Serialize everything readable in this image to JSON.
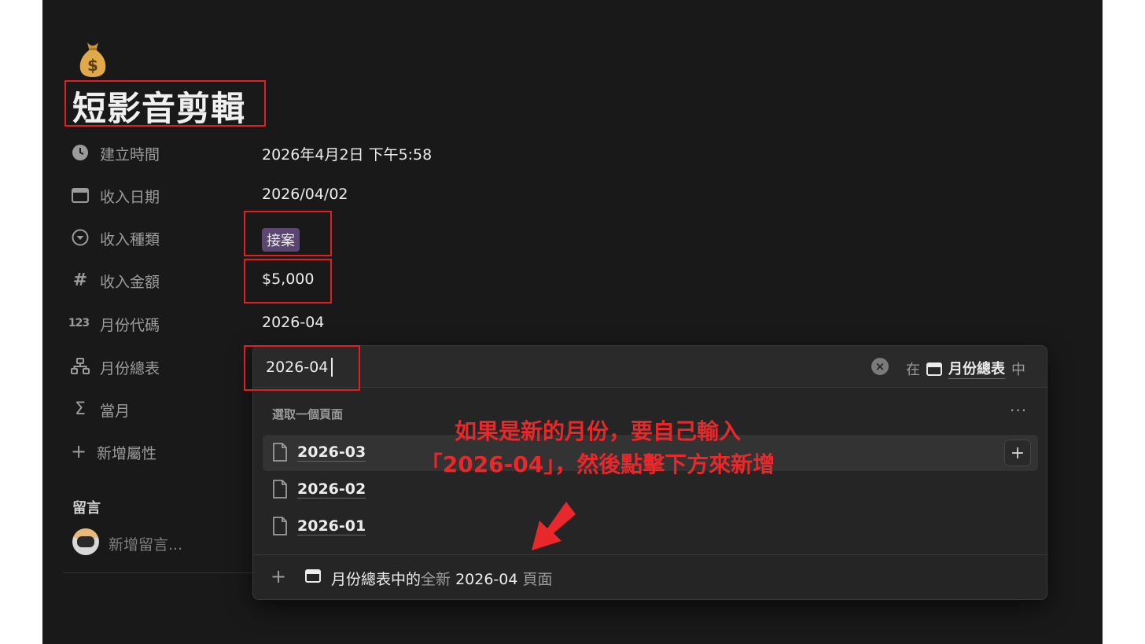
{
  "page": {
    "icon": "money-bag-icon",
    "title": "短影音剪輯"
  },
  "properties": [
    {
      "icon": "clock-icon",
      "label": "建立時間",
      "value": "2026年4月2日 下午5:58"
    },
    {
      "icon": "calendar-icon",
      "label": "收入日期",
      "value": "2026/04/02"
    },
    {
      "icon": "select-icon",
      "label": "收入種類",
      "tag": "接案",
      "tag_color": "#5a4670"
    },
    {
      "icon": "hash-icon",
      "label": "收入金額",
      "value": "$5,000"
    },
    {
      "icon": "formula-123-icon",
      "label": "月份代碼",
      "value": "2026-04"
    },
    {
      "icon": "relation-icon",
      "label": "月份總表"
    },
    {
      "icon": "sigma-icon",
      "label": "當月"
    },
    {
      "icon": "plus-icon",
      "label": "新增屬性"
    }
  ],
  "comments": {
    "label": "留言",
    "placeholder": "新增留言..."
  },
  "relation_popup": {
    "search_value": "2026-04",
    "in_prefix": "在",
    "database_name": "月份總表",
    "in_suffix": "中",
    "section_label": "選取一個頁面",
    "more_label": "···",
    "options": [
      "2026-03",
      "2026-02",
      "2026-01"
    ],
    "create": {
      "db_text": "月份總表中的",
      "new_text": "全新",
      "value_text": "2026-04",
      "page_text": "頁面"
    }
  },
  "annotation": {
    "line1": "如果是新的月份，要自己輸入",
    "line2": "「2026-04」，然後點擊下方來新增",
    "color": "#e8282a"
  }
}
